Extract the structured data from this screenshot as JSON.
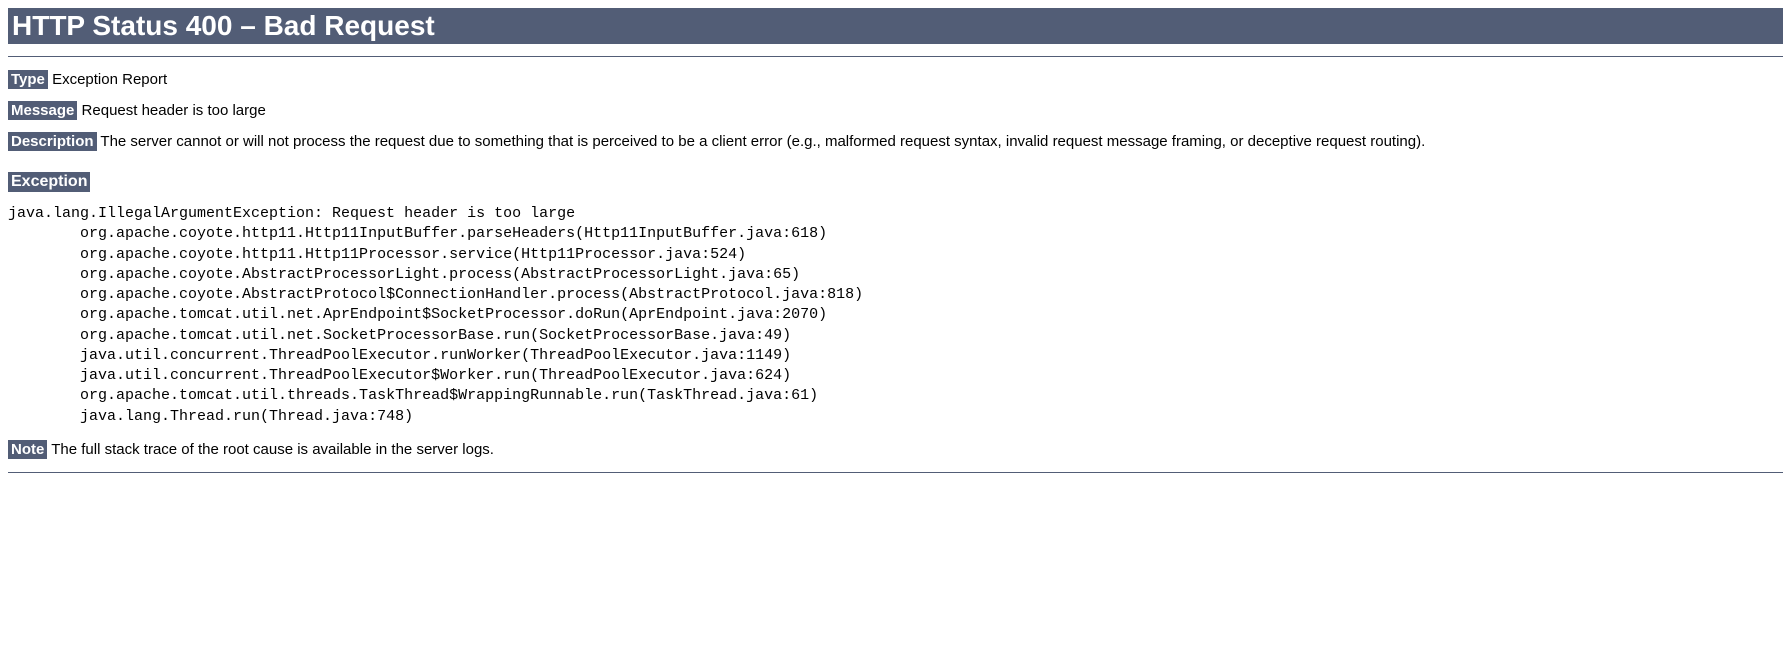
{
  "title": "HTTP Status 400 – Bad Request",
  "labels": {
    "type": "Type",
    "message": "Message",
    "description": "Description",
    "exception": "Exception",
    "note": "Note"
  },
  "type_value": "Exception Report",
  "message_value": "Request header is too large",
  "description_value": "The server cannot or will not process the request due to something that is perceived to be a client error (e.g., malformed request syntax, invalid request message framing, or deceptive request routing).",
  "stack_trace": "java.lang.IllegalArgumentException: Request header is too large\n\torg.apache.coyote.http11.Http11InputBuffer.parseHeaders(Http11InputBuffer.java:618)\n\torg.apache.coyote.http11.Http11Processor.service(Http11Processor.java:524)\n\torg.apache.coyote.AbstractProcessorLight.process(AbstractProcessorLight.java:65)\n\torg.apache.coyote.AbstractProtocol$ConnectionHandler.process(AbstractProtocol.java:818)\n\torg.apache.tomcat.util.net.AprEndpoint$SocketProcessor.doRun(AprEndpoint.java:2070)\n\torg.apache.tomcat.util.net.SocketProcessorBase.run(SocketProcessorBase.java:49)\n\tjava.util.concurrent.ThreadPoolExecutor.runWorker(ThreadPoolExecutor.java:1149)\n\tjava.util.concurrent.ThreadPoolExecutor$Worker.run(ThreadPoolExecutor.java:624)\n\torg.apache.tomcat.util.threads.TaskThread$WrappingRunnable.run(TaskThread.java:61)\n\tjava.lang.Thread.run(Thread.java:748)",
  "note_value": "The full stack trace of the root cause is available in the server logs."
}
